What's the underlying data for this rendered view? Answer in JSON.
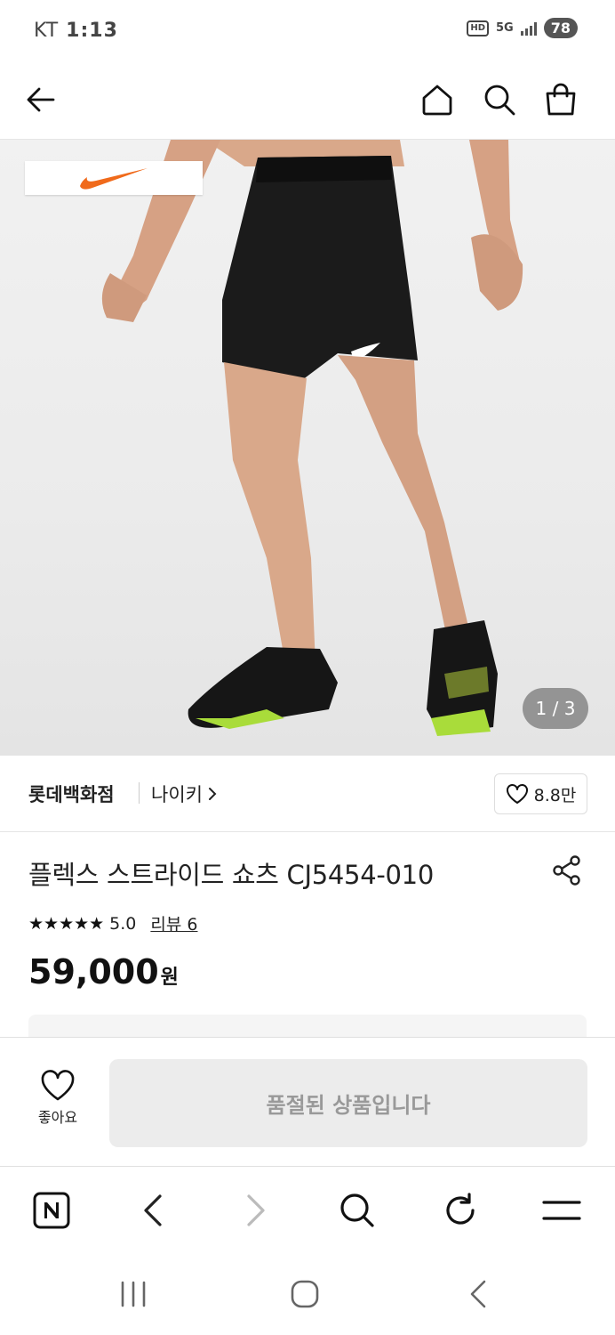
{
  "status_bar": {
    "carrier": "KT",
    "time": "1:13",
    "hd": "HD",
    "network": "5G",
    "battery": "78"
  },
  "top_nav": {
    "back_icon": "arrow-left-icon",
    "home_icon": "home-icon",
    "search_icon": "search-icon",
    "cart_icon": "shopping-bag-icon"
  },
  "gallery": {
    "counter": "1 / 3",
    "brand_logo": "nike-swoosh-icon"
  },
  "seller": {
    "store": "롯데백화점",
    "brand": "나이키",
    "like_count": "8.8만"
  },
  "product": {
    "title": "플렉스 스트라이드 쇼츠 CJ5454-010",
    "stars": "★★★★★",
    "rating": "5.0",
    "review_label": "리뷰 6",
    "price": "59,000",
    "currency": "원"
  },
  "bottom_action": {
    "like_label": "좋아요",
    "soldout_label": "품절된 상품입니다"
  },
  "browser_bar": {
    "home_icon": "naver-n-icon",
    "back_icon": "chevron-left-icon",
    "forward_icon": "chevron-right-icon",
    "search_icon": "search-icon",
    "refresh_icon": "refresh-icon",
    "menu_icon": "menu-icon"
  },
  "system_nav": {
    "recents_icon": "recents-icon",
    "home_icon": "home-circle-icon",
    "back_icon": "back-chevron-icon"
  },
  "colors": {
    "nike_orange": "#f06a1b",
    "soldout_bg": "#ececec",
    "soldout_text": "#999999"
  }
}
